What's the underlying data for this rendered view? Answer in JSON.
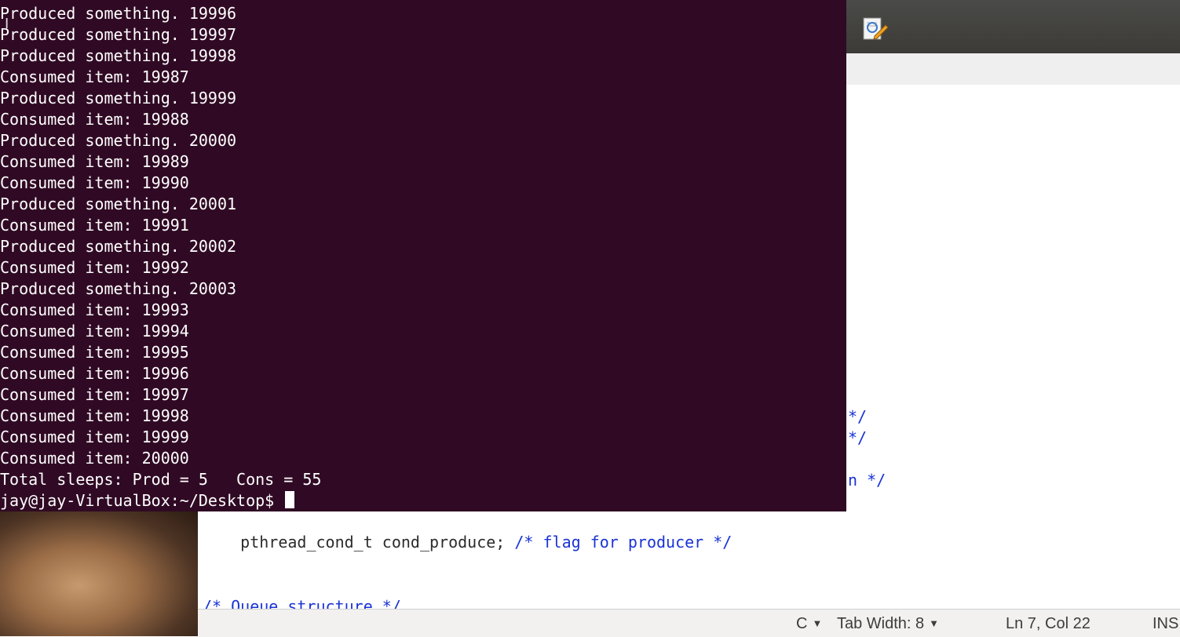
{
  "terminal": {
    "lines": [
      "Produced something. 19996",
      "Produced something. 19997",
      "Produced something. 19998",
      "Consumed item: 19987",
      "Produced something. 19999",
      "Consumed item: 19988",
      "Produced something. 20000",
      "Consumed item: 19989",
      "Consumed item: 19990",
      "Produced something. 20001",
      "Consumed item: 19991",
      "Produced something. 20002",
      "Consumed item: 19992",
      "Produced something. 20003",
      "Consumed item: 19993",
      "Consumed item: 19994",
      "Consumed item: 19995",
      "Consumed item: 19996",
      "Consumed item: 19997",
      "Consumed item: 19998",
      "Consumed item: 19999",
      "Consumed item: 20000",
      "Total sleeps: Prod = 5   Cons = 55"
    ],
    "prompt": "jay@jay-VirtualBox:~/Desktop$ "
  },
  "editor": {
    "toolbar_icon": "edit-document-icon",
    "visible_fragments": [
      "*/",
      "*/",
      "n */"
    ],
    "code_line": {
      "code": "pthread_cond_t cond_produce; ",
      "comment": "/* flag for producer */"
    },
    "partial_comment": "/* Queue structure */"
  },
  "statusbar": {
    "language": "C",
    "tab_width": "Tab Width: 8",
    "position": "Ln 7, Col 22",
    "mode": "INS"
  },
  "colors": {
    "terminal_bg": "#300a24",
    "terminal_fg": "#ffffff",
    "comment": "#1a33d6"
  }
}
